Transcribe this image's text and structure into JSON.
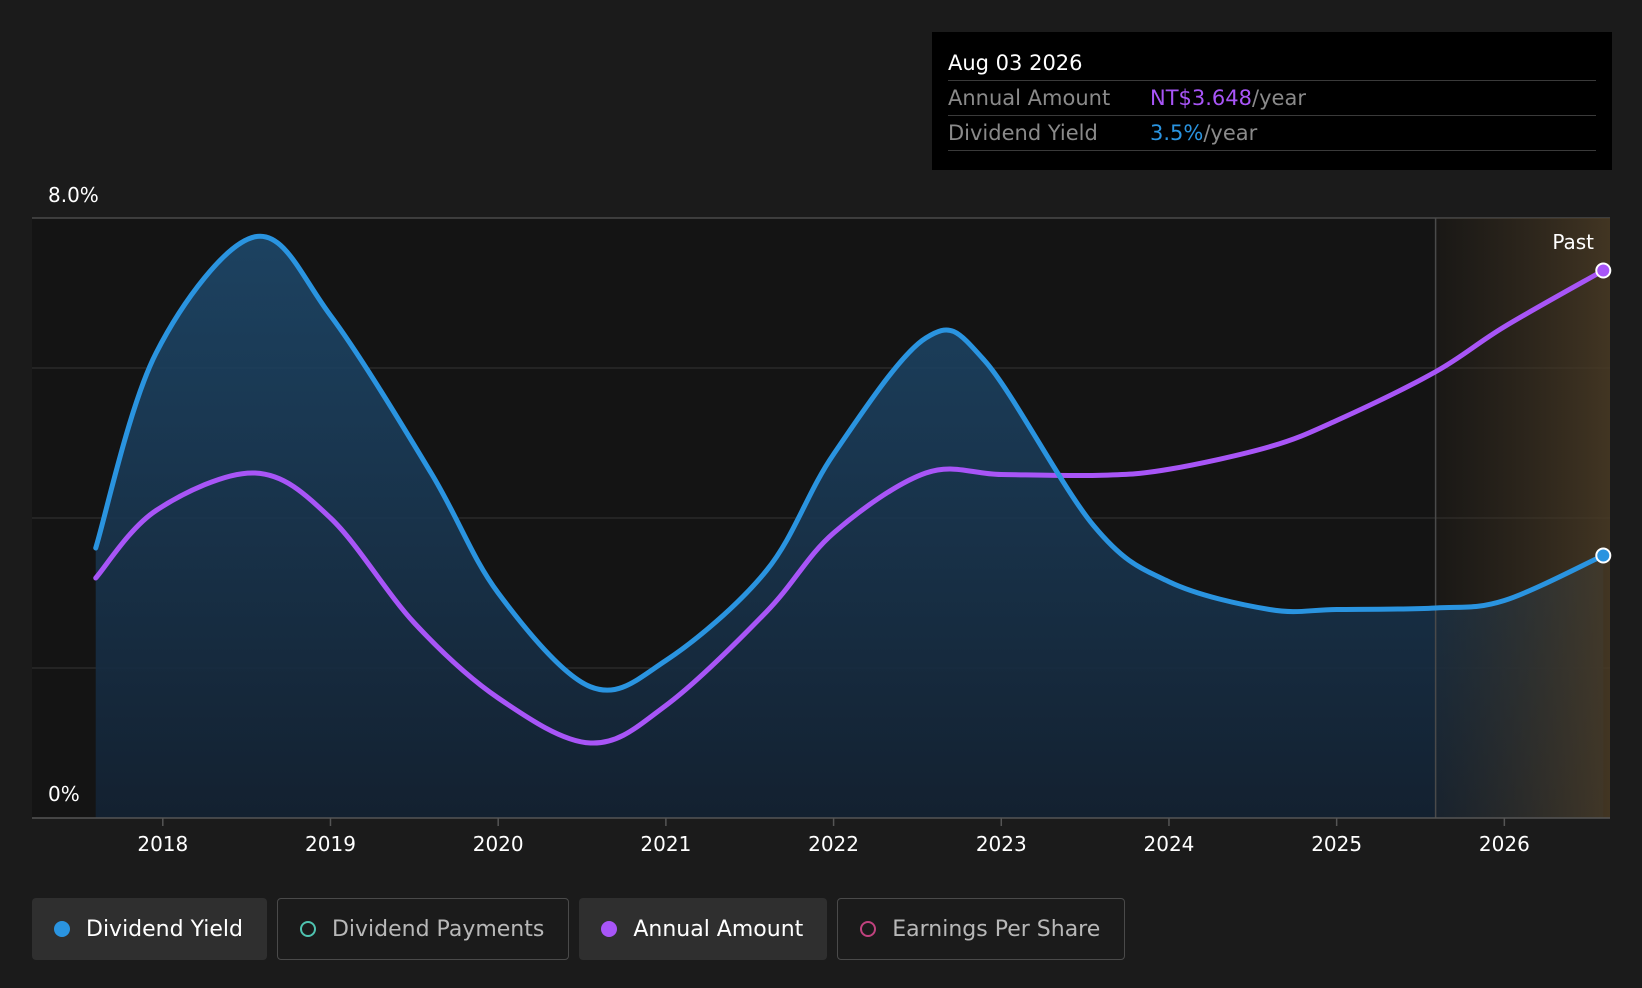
{
  "tooltip": {
    "date": "Aug 03 2026",
    "rows": [
      {
        "label": "Annual Amount",
        "value": "NT$3.648",
        "unit": "/year"
      },
      {
        "label": "Dividend Yield",
        "value": "3.5%",
        "unit": "/year"
      }
    ]
  },
  "past_label": "Past",
  "legend": [
    {
      "label": "Dividend Yield",
      "color": "#2a94e0",
      "active": true
    },
    {
      "label": "Dividend Payments",
      "color": "#4fc3b0",
      "active": false
    },
    {
      "label": "Annual Amount",
      "color": "#a855f7",
      "active": true
    },
    {
      "label": "Earnings Per Share",
      "color": "#c0427e",
      "active": false
    }
  ],
  "colors": {
    "yield": "#2a94e0",
    "amount": "#a855f7",
    "grid": "#333333",
    "background": "#1b1b1b",
    "plot_bg": "#141414"
  },
  "chart_data": {
    "type": "line",
    "title": "",
    "xlabel": "",
    "ylabel": "",
    "ylim": [
      0,
      8.0
    ],
    "y_tick_labels": [
      "0%",
      "8.0%"
    ],
    "x_tick_labels": [
      "2018",
      "2019",
      "2020",
      "2021",
      "2022",
      "2023",
      "2024",
      "2025",
      "2026"
    ],
    "xlim": [
      2017.22,
      2026.63
    ],
    "past_from": 2025.59,
    "series": [
      {
        "name": "Dividend Yield",
        "x": [
          2017.6,
          2017.96,
          2018.55,
          2019.0,
          2019.6,
          2020.0,
          2020.55,
          2021.0,
          2021.6,
          2022.0,
          2022.55,
          2022.9,
          2023.55,
          2024.0,
          2024.6,
          2025.0,
          2025.59,
          2026.0,
          2026.59
        ],
        "values": [
          3.6,
          6.2,
          7.75,
          6.7,
          4.6,
          3.0,
          1.75,
          2.1,
          3.3,
          4.85,
          6.4,
          6.1,
          3.9,
          3.15,
          2.78,
          2.78,
          2.8,
          2.9,
          3.5
        ]
      },
      {
        "name": "Annual Amount",
        "x": [
          2017.6,
          2017.96,
          2018.55,
          2019.0,
          2019.5,
          2020.0,
          2020.55,
          2021.0,
          2021.6,
          2022.0,
          2022.55,
          2023.0,
          2023.6,
          2024.0,
          2024.6,
          2025.0,
          2025.59,
          2026.0,
          2026.59
        ],
        "values": [
          3.2,
          4.1,
          4.6,
          4.0,
          2.6,
          1.6,
          1.0,
          1.5,
          2.75,
          3.8,
          4.6,
          4.58,
          4.57,
          4.65,
          4.95,
          5.3,
          5.95,
          6.55,
          7.3
        ],
        "display_value": "NT$3.648"
      }
    ]
  }
}
